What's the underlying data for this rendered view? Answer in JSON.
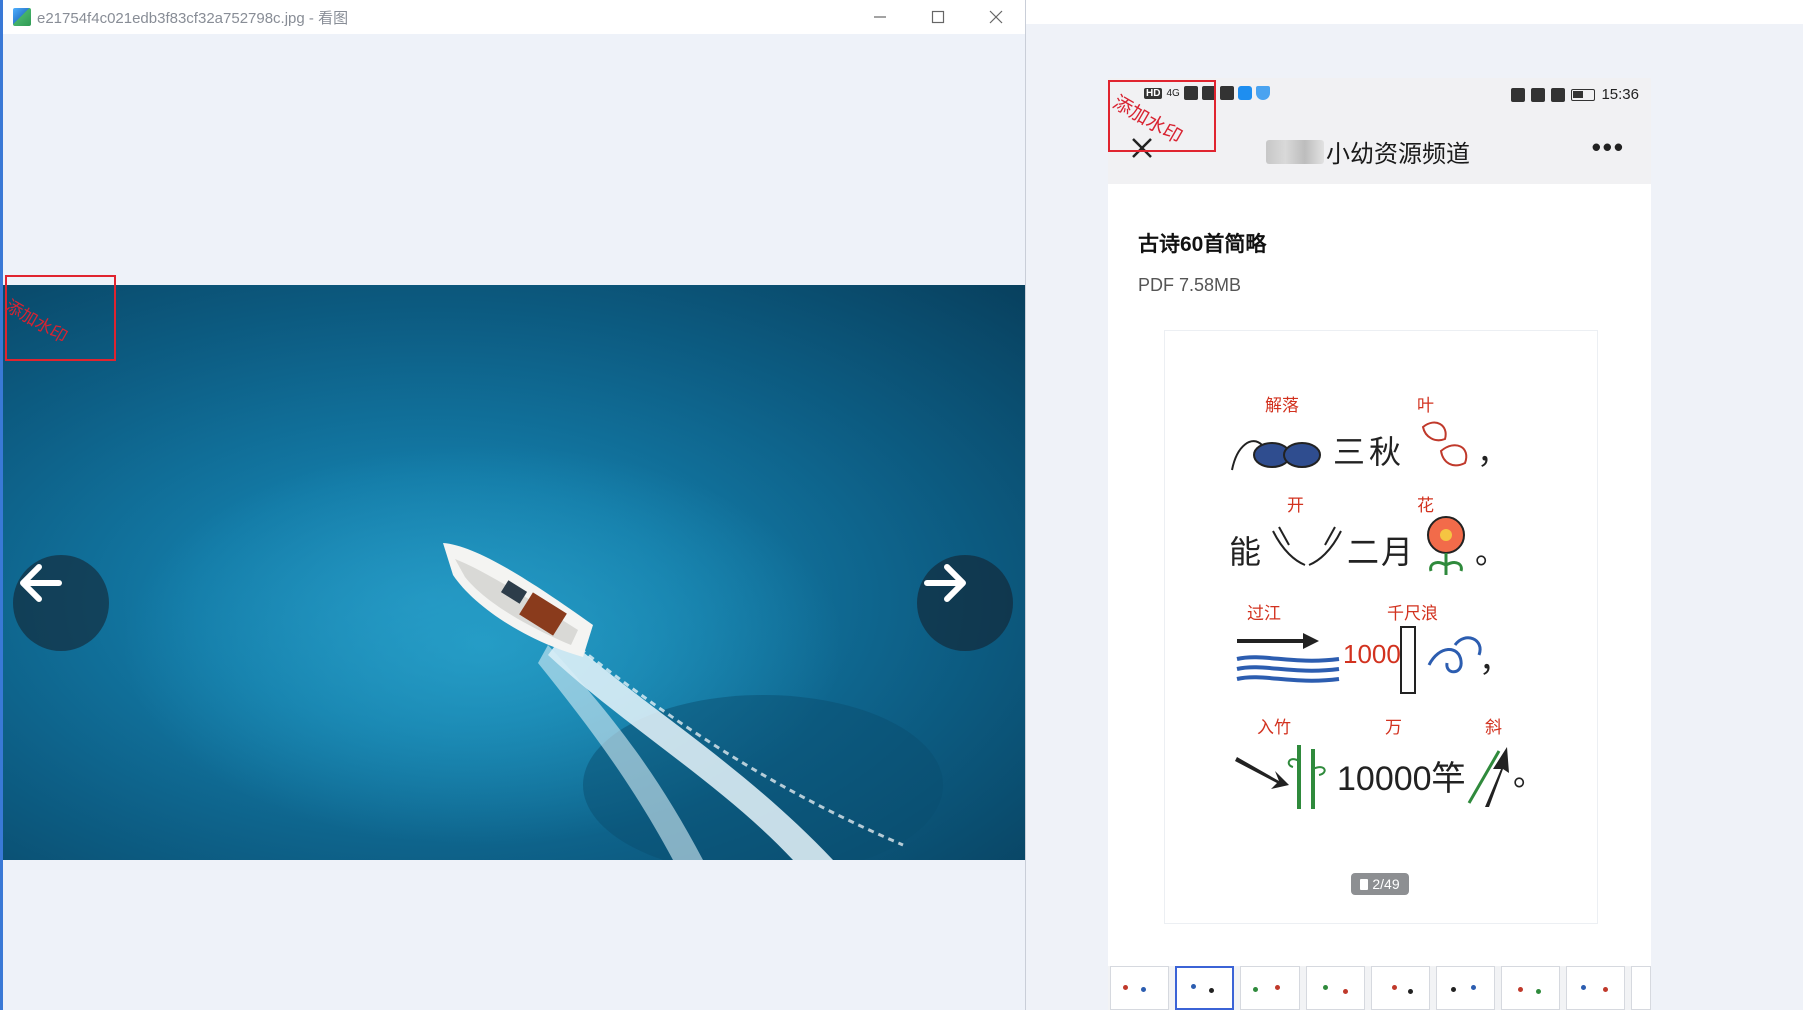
{
  "viewer": {
    "title": "e21754f4c021edb3f83cf32a752798c.jpg - 看图",
    "controls": [
      "minimize",
      "maximize",
      "close"
    ],
    "watermark": "添加水印",
    "nav": {
      "prev": "previous-image",
      "next": "next-image"
    }
  },
  "phone": {
    "status": {
      "time": "15:36",
      "signal": "4G",
      "hd": "HD"
    },
    "watermark": "添加水印",
    "channel_name": "小幼资源频道",
    "doc": {
      "title": "古诗60首简略",
      "meta": "PDF 7.58MB"
    },
    "page_indicator": "2/49",
    "poem": {
      "line1": {
        "labels": [
          "解落",
          "叶"
        ],
        "chars": [
          "三",
          "秋"
        ],
        "punct": "，"
      },
      "line2": {
        "labels": [
          "开",
          "花"
        ],
        "chars": [
          "能",
          "二",
          "月"
        ],
        "punct": "。"
      },
      "line3": {
        "labels": [
          "过江",
          "千尺浪"
        ],
        "number": "1000",
        "punct": "，"
      },
      "line4": {
        "labels": [
          "入竹",
          "万",
          "斜"
        ],
        "number": "10000竿",
        "punct": "。"
      }
    },
    "thumbnail_count": 9,
    "selected_thumbnail": 2
  },
  "colors": {
    "accent": "#3b63d6",
    "watermark_red": "#d82331",
    "sea": "#137aa6"
  }
}
